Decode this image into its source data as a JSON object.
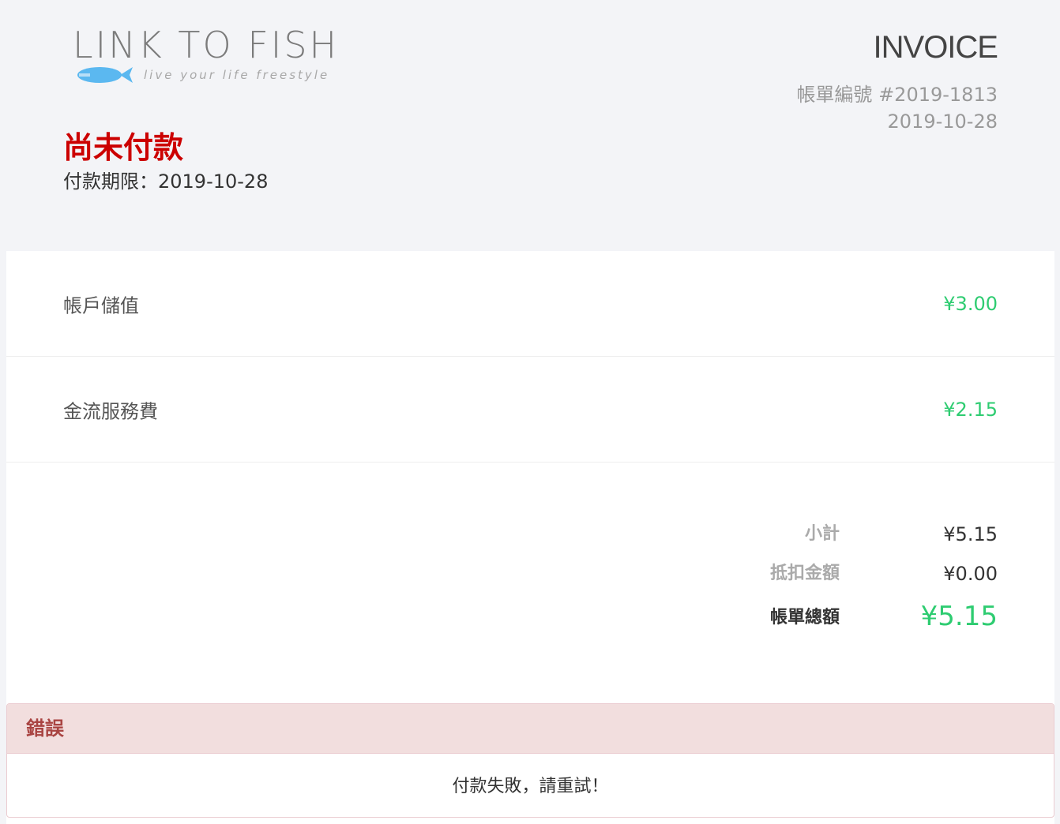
{
  "logo": {
    "title": "LINK TO FISH",
    "tagline": "live your life freestyle",
    "fish_color": "#5bb8f0"
  },
  "invoice": {
    "title": "INVOICE",
    "number": "帳單編號 #2019-1813",
    "date": "2019-10-28"
  },
  "status": {
    "label": "尚未付款",
    "due": "付款期限：2019-10-28",
    "color": "#cc0000"
  },
  "items": [
    {
      "name": "帳戶儲值",
      "amount": "¥3.00"
    },
    {
      "name": "金流服務費",
      "amount": "¥2.15"
    }
  ],
  "summary": {
    "subtotal_label": "小計",
    "subtotal_value": "¥5.15",
    "discount_label": "抵扣金額",
    "discount_value": "¥0.00",
    "total_label": "帳單總額",
    "total_value": "¥5.15"
  },
  "error": {
    "heading": "錯誤",
    "message": "付款失敗，請重試！"
  },
  "colors": {
    "accent_green": "#2ecc71",
    "error_red": "#a94442",
    "error_bg": "#f2dede",
    "header_bg": "#f3f4f7"
  }
}
